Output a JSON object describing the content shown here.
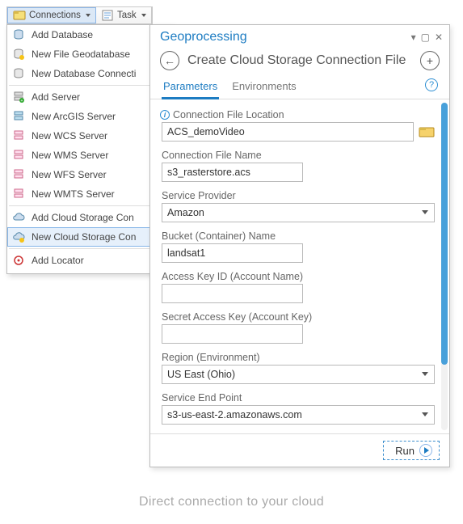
{
  "toolbar": {
    "connections_label": "Connections",
    "task_label": "Task"
  },
  "menu": {
    "groups": [
      {
        "items": [
          {
            "label": "Add Database",
            "icon": "db-add"
          },
          {
            "label": "New File Geodatabase",
            "icon": "db-new"
          },
          {
            "label": "New Database Connecti",
            "icon": "db-conn"
          }
        ]
      },
      {
        "items": [
          {
            "label": "Add Server",
            "icon": "srv-add"
          },
          {
            "label": "New ArcGIS Server",
            "icon": "srv-ags"
          },
          {
            "label": "New WCS Server",
            "icon": "srv"
          },
          {
            "label": "New WMS Server",
            "icon": "srv"
          },
          {
            "label": "New WFS Server",
            "icon": "srv"
          },
          {
            "label": "New WMTS Server",
            "icon": "srv"
          }
        ]
      },
      {
        "items": [
          {
            "label": "Add Cloud Storage Con",
            "icon": "cloud-add"
          },
          {
            "label": "New Cloud Storage Con",
            "icon": "cloud-new",
            "highlight": true
          }
        ]
      },
      {
        "items": [
          {
            "label": "Add Locator",
            "icon": "locator"
          }
        ]
      }
    ]
  },
  "panel": {
    "title": "Geoprocessing",
    "tool_title": "Create Cloud Storage Connection File",
    "tabs": {
      "parameters": "Parameters",
      "environments": "Environments"
    },
    "fields": {
      "conn_loc_label": "Connection File Location",
      "conn_loc_value": "ACS_demoVideo",
      "conn_name_label": "Connection File Name",
      "conn_name_value": "s3_rasterstore.acs",
      "provider_label": "Service Provider",
      "provider_value": "Amazon",
      "bucket_label": "Bucket (Container) Name",
      "bucket_value": "landsat1",
      "access_key_label": "Access Key ID (Account Name)",
      "access_key_value": "",
      "secret_key_label": "Secret Access Key (Account Key)",
      "secret_key_value": "",
      "region_label": "Region (Environment)",
      "region_value": "US East (Ohio)",
      "endpoint_label": "Service End Point",
      "endpoint_value": "s3-us-east-2.amazonaws.com"
    },
    "run_label": "Run"
  },
  "caption": "Direct connection to your cloud"
}
